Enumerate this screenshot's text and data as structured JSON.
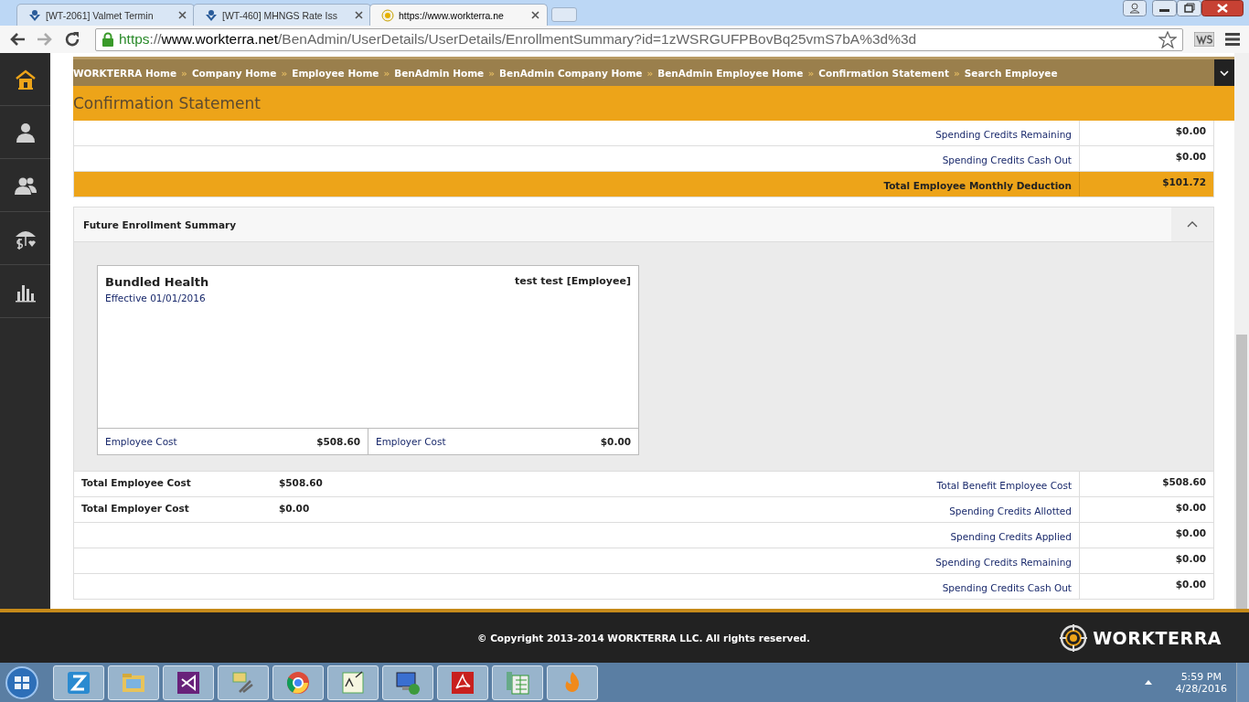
{
  "browser": {
    "tabs": [
      {
        "title": "[WT-2061] Valmet Termin",
        "selected": false
      },
      {
        "title": "[WT-460] MHNGS Rate Iss",
        "selected": false
      },
      {
        "title": "https://www.workterra.ne",
        "selected": true
      }
    ],
    "url": {
      "scheme": "https",
      "separator": "://",
      "host": "www.workterra.net",
      "path": "/BenAdmin/UserDetails/UserDetails/EnrollmentSummary?id=1zWSRGUFPBovBq25vmS7bA%3d%3d"
    }
  },
  "sidebar": {
    "items": [
      {
        "selected": true
      },
      {
        "selected": false
      },
      {
        "selected": false
      },
      {
        "selected": false
      },
      {
        "selected": false
      }
    ]
  },
  "breadcrumb_separator": "»",
  "breadcrumbs": [
    "WORKTERRA Home",
    "Company Home",
    "Employee Home",
    "BenAdmin Home",
    "BenAdmin Company Home",
    "BenAdmin Employee Home",
    "Confirmation Statement",
    "Search Employee"
  ],
  "page_title": "Confirmation Statement",
  "summary_rows": [
    {
      "label": "Spending Credits Remaining",
      "value": "$0.00",
      "kind": "plain"
    },
    {
      "label": "Spending Credits Cash Out",
      "value": "$0.00",
      "kind": "plain"
    },
    {
      "label": "Total Employee Monthly Deduction",
      "value": "$101.72",
      "kind": "total"
    }
  ],
  "future_panel": {
    "title": "Future Enrollment Summary",
    "expanded": true,
    "card": {
      "plan": "Bundled Health",
      "effective": "Effective 01/01/2016",
      "member": "test test [Employee]",
      "costs": [
        {
          "label": "Employee Cost",
          "value": "$508.60"
        },
        {
          "label": "Employer Cost",
          "value": "$0.00"
        }
      ]
    }
  },
  "totals_rows": [
    {
      "left_label": "Total Employee Cost",
      "left_value": "$508.60",
      "right_label": "Total Benefit Employee Cost",
      "right_value": "$508.60"
    },
    {
      "left_label": "Total Employer Cost",
      "left_value": "$0.00",
      "right_label": "Spending Credits Allotted",
      "right_value": "$0.00"
    },
    {
      "right_label": "Spending Credits Applied",
      "right_value": "$0.00"
    },
    {
      "right_label": "Spending Credits Remaining",
      "right_value": "$0.00"
    },
    {
      "right_label": "Spending Credits Cash Out",
      "right_value": "$0.00"
    }
  ],
  "footer": {
    "copyright": "© Copyright 2013-2014 WORKTERRA LLC. All rights reserved.",
    "logo": "WORKTERRA"
  },
  "taskbar": {
    "time": "5:59 PM",
    "date": "4/28/2016"
  }
}
